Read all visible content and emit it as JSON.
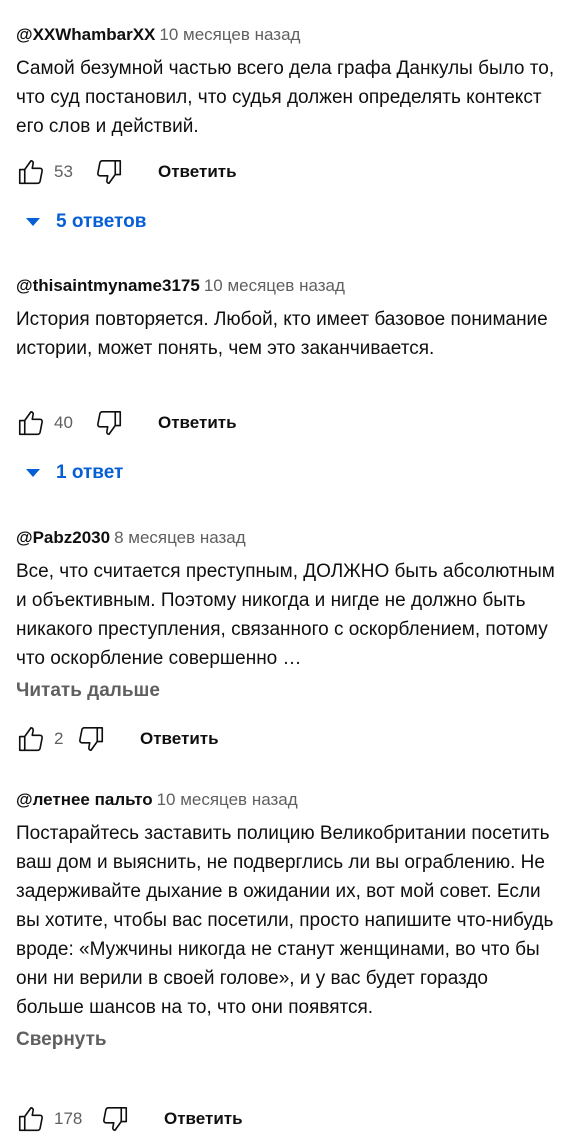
{
  "comments": [
    {
      "author": "@XXWhambarXX",
      "time": "10 месяцев назад",
      "text": "Самой безумной частью всего дела графа Данкулы было то, что суд постановил, что судья должен определять контекст его слов и действий.",
      "likes": "53",
      "reply_label": "Ответить",
      "replies_label": "5 ответов"
    },
    {
      "author": "@thisaintmyname3175",
      "time": "10 месяцев назад",
      "text": "История повторяется. Любой, кто имеет базовое понимание истории, может понять, чем это заканчивается.",
      "likes": "40",
      "reply_label": "Ответить",
      "replies_label": "1 ответ"
    },
    {
      "author": "@Pabz2030",
      "time": "8 месяцев назад",
      "text": "Все, что считается преступным, ДОЛЖНО быть абсолютным и объективным. Поэтому никогда и нигде не должно быть никакого преступления, связанного с оскорблением, потому что оскорбление совершенно …",
      "more_label": "Читать дальше",
      "likes": "2",
      "reply_label": "Ответить"
    },
    {
      "author": "@летнее пальто",
      "time": "10 месяцев назад",
      "text": "Постарайтесь заставить полицию Великобритании посетить ваш дом и выяснить, не подверглись ли вы ограблению. Не задерживайте дыхание в ожидании их, вот мой совет. Если вы хотите, чтобы вас посетили, просто напишите что-нибудь вроде: «Мужчины никогда не станут женщинами, во что бы они ни верили в своей голове», и у вас будет гораздо больше шансов на то, что они появятся.",
      "more_label": "Свернуть",
      "likes": "178",
      "reply_label": "Ответить"
    }
  ],
  "icons": {
    "like": "thumbs-up-icon",
    "dislike": "thumbs-down-icon",
    "expand": "caret-down-icon"
  },
  "colors": {
    "link": "#065fd4",
    "secondary": "#606060",
    "text": "#0f0f0f"
  }
}
